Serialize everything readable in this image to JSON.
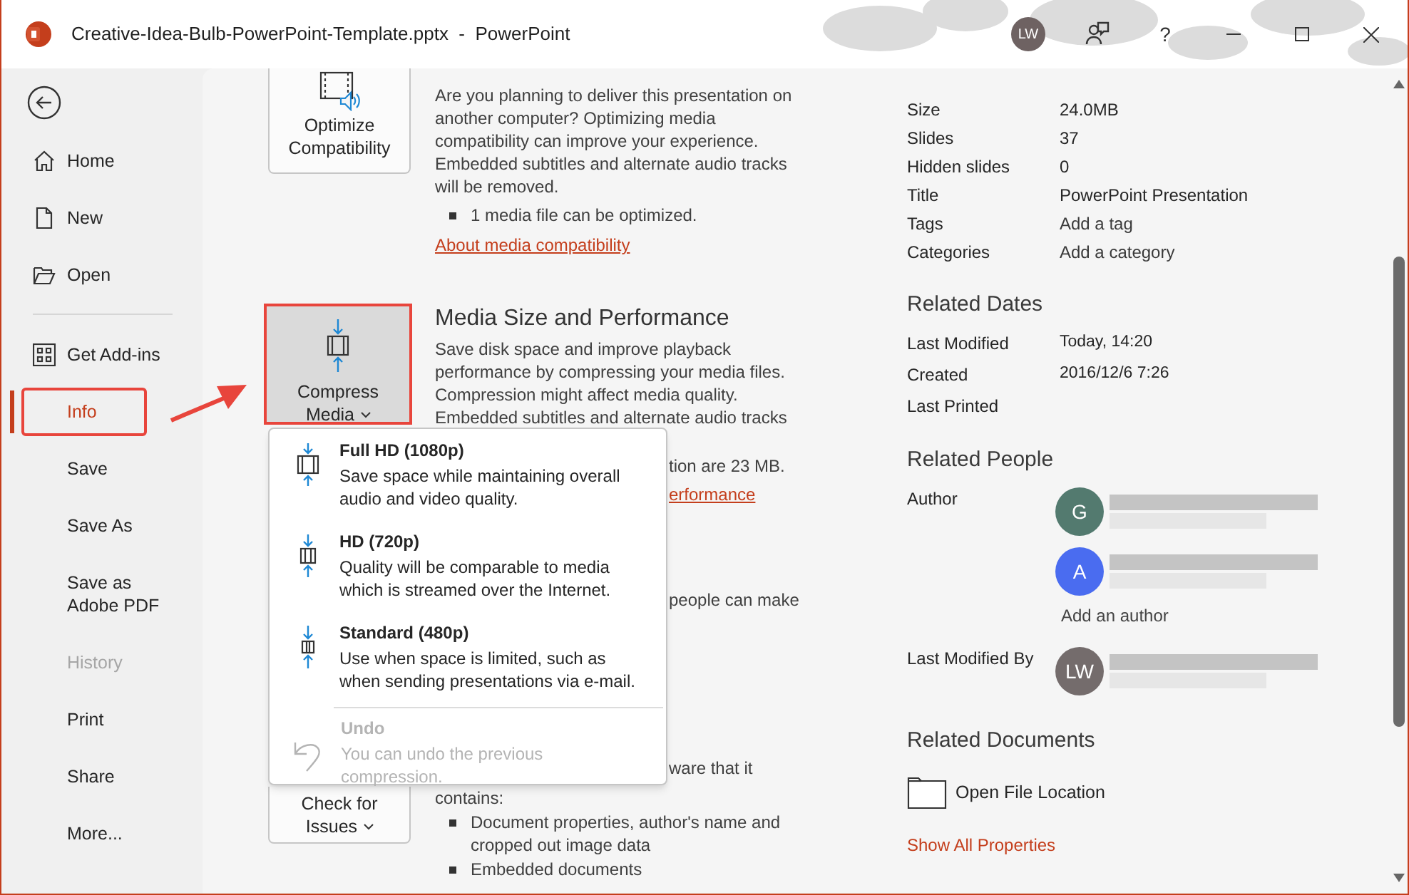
{
  "window": {
    "title": "Creative-Idea-Bulb-PowerPoint-Template.pptx  -  PowerPoint",
    "account_initials": "LW",
    "help": "?"
  },
  "nav": {
    "top_items": [
      {
        "label": "Home",
        "selected": false,
        "disabled": false,
        "callout": false
      },
      {
        "label": "New",
        "selected": false,
        "disabled": false,
        "callout": false
      },
      {
        "label": "Open",
        "selected": false,
        "disabled": false,
        "callout": false
      }
    ],
    "items": [
      {
        "label": "Get Add-ins",
        "selected": false,
        "disabled": false,
        "callout": false
      },
      {
        "label": "Info",
        "selected": true,
        "disabled": false,
        "callout": true
      },
      {
        "label": "Save",
        "selected": false,
        "disabled": false,
        "callout": false
      },
      {
        "label": "Save As",
        "selected": false,
        "disabled": false,
        "callout": false
      },
      {
        "label": "Save as Adobe PDF",
        "selected": false,
        "disabled": false,
        "callout": false
      },
      {
        "label": "History",
        "selected": false,
        "disabled": true,
        "callout": false
      },
      {
        "label": "Print",
        "selected": false,
        "disabled": false,
        "callout": false
      },
      {
        "label": "Share",
        "selected": false,
        "disabled": false,
        "callout": false
      },
      {
        "label": "More...",
        "selected": false,
        "disabled": false,
        "callout": false
      }
    ]
  },
  "sections": [
    {
      "button": {
        "label": "Optimize Compatibility"
      },
      "description": "Are you planning to deliver this presentation on another computer? Optimizing media compatibility can improve your experience. Embedded subtitles and alternate audio tracks will be removed.",
      "bullets": [
        "1 media file can be optimized."
      ],
      "link": "About media compatibility"
    },
    {
      "heading": "Media Size and Performance",
      "button": {
        "label": "Compress Media",
        "dropdown": true,
        "callout": true
      },
      "description": "Save disk space and improve playback performance by compressing your media files. Compression might affect media quality. Embedded subtitles and alternate audio tracks",
      "fragments": [
        {
          "text": "tion are 23 MB.",
          "kind": "text"
        },
        {
          "text": "erformance",
          "kind": "link"
        }
      ]
    },
    {
      "fragments": [
        {
          "text": "people can make",
          "kind": "text"
        }
      ]
    },
    {
      "button": {
        "label": "Check for Issues",
        "dropdown": true
      },
      "fragments": [
        {
          "text": "ware that it",
          "kind": "text"
        }
      ],
      "description": "contains:",
      "bullets": [
        "Document properties, author's name and cropped out image data",
        "Embedded documents"
      ]
    }
  ],
  "compress_menu": {
    "items": [
      {
        "kind": "full_hd",
        "title": "Full HD (1080p)",
        "description": "Save space while maintaining overall audio and video quality.",
        "disabled": false
      },
      {
        "kind": "hd",
        "title": "HD (720p)",
        "description": "Quality will be comparable to media which is streamed over the Internet.",
        "disabled": false
      },
      {
        "kind": "standard",
        "title": "Standard (480p)",
        "description": "Use when space is limited, such as when sending presentations via e-mail.",
        "disabled": false
      },
      {
        "kind": "undo",
        "title": "Undo",
        "description": "You can undo the previous compression.",
        "disabled": true
      }
    ]
  },
  "properties": {
    "rows": [
      {
        "label": "Size",
        "value": "24.0MB",
        "kind": "text"
      },
      {
        "label": "Slides",
        "value": "37",
        "kind": "text"
      },
      {
        "label": "Hidden slides",
        "value": "0",
        "kind": "text"
      },
      {
        "label": "Title",
        "value": "PowerPoint Presentation",
        "kind": "text"
      },
      {
        "label": "Tags",
        "value": "Add a tag",
        "kind": "link"
      },
      {
        "label": "Categories",
        "value": "Add a category",
        "kind": "link"
      }
    ]
  },
  "related_dates": {
    "heading": "Related Dates",
    "rows": [
      {
        "label": "Last Modified",
        "value": "Today, 14:20"
      },
      {
        "label": "Created",
        "value": "2016/12/6 7:26"
      },
      {
        "label": "Last Printed"
      }
    ]
  },
  "related_people": {
    "heading": "Related People",
    "author_label": "Author",
    "authors": [
      {
        "initials": "G",
        "color": "#537a6f",
        "name_redacted": true
      },
      {
        "initials": "A",
        "color": "#4a6cf0",
        "name_redacted": true
      }
    ],
    "add_author": "Add an author",
    "last_modified_label": "Last Modified By",
    "last_modified_by": {
      "initials": "LW",
      "color": "#746c6c",
      "name_redacted": true
    }
  },
  "related_documents": {
    "heading": "Related Documents",
    "items": [
      {
        "label": "Open File Location"
      }
    ]
  },
  "show_all_link": "Show All Properties"
}
